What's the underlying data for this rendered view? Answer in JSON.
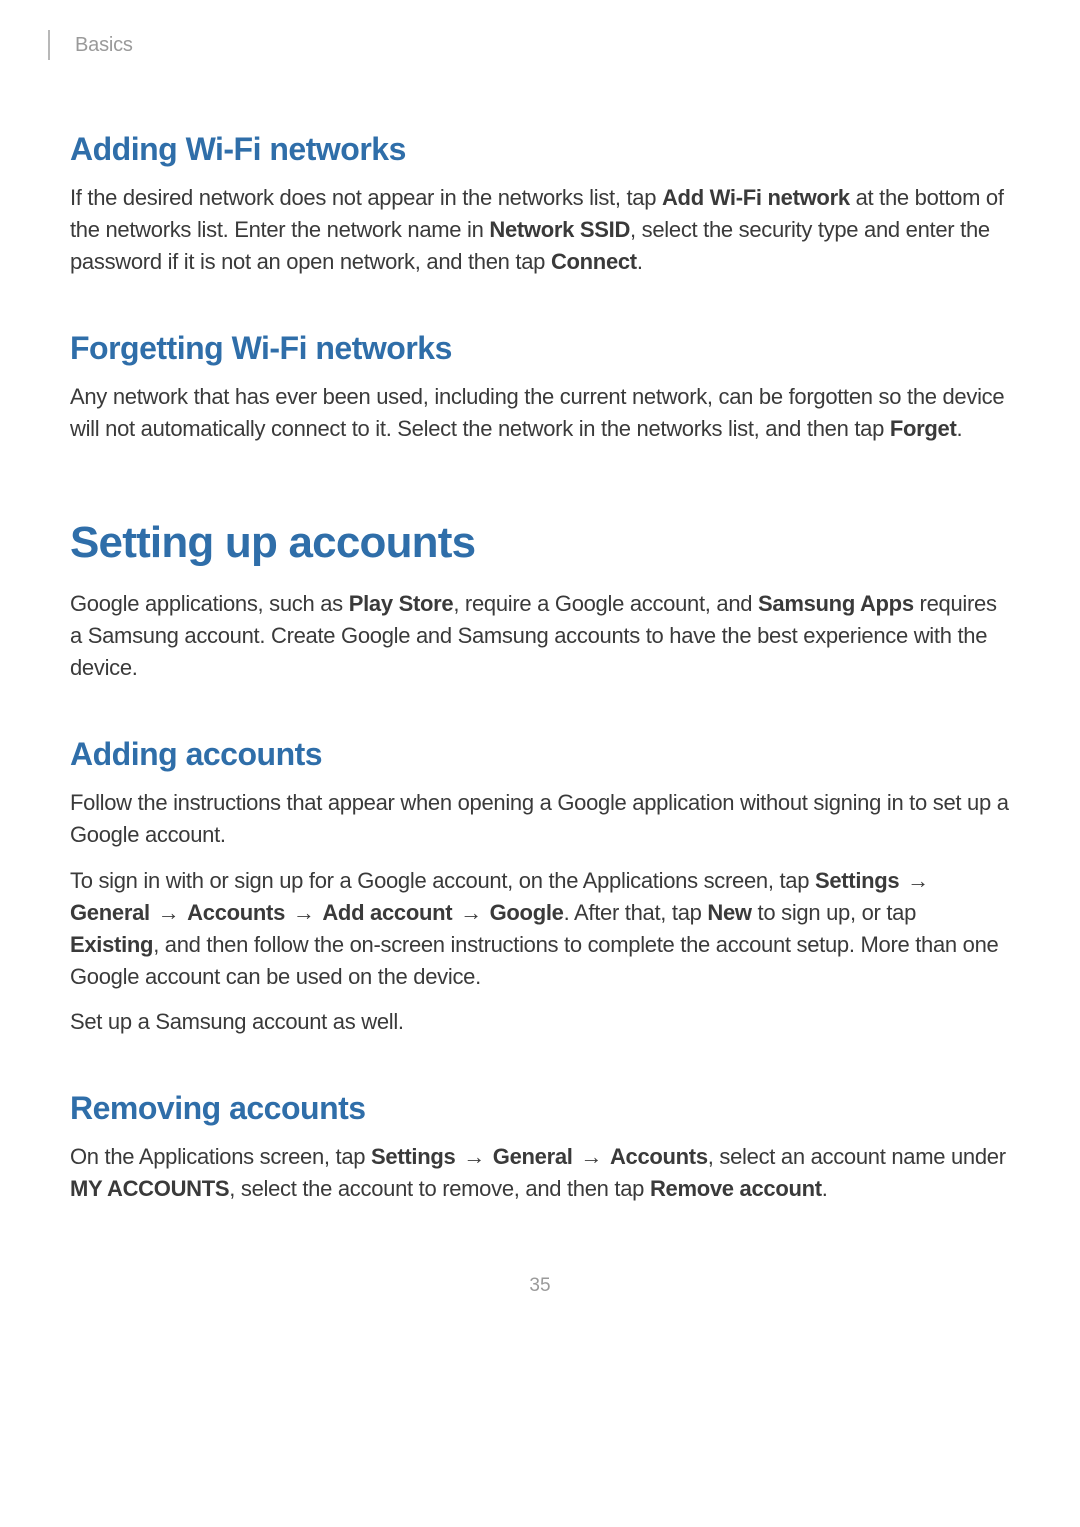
{
  "header": {
    "breadcrumb": "Basics"
  },
  "sections": {
    "adding_wifi": {
      "heading": "Adding Wi-Fi networks",
      "p1_pre": "If the desired network does not appear in the networks list, tap ",
      "p1_b1": "Add Wi-Fi network",
      "p1_mid1": " at the bottom of the networks list. Enter the network name in ",
      "p1_b2": "Network SSID",
      "p1_mid2": ", select the security type and enter the password if it is not an open network, and then tap ",
      "p1_b3": "Connect",
      "p1_post": "."
    },
    "forgetting_wifi": {
      "heading": "Forgetting Wi-Fi networks",
      "p1_pre": "Any network that has ever been used, including the current network, can be forgotten so the device will not automatically connect to it. Select the network in the networks list, and then tap ",
      "p1_b1": "Forget",
      "p1_post": "."
    },
    "setting_up": {
      "heading": "Setting up accounts",
      "p1_pre": "Google applications, such as ",
      "p1_b1": "Play Store",
      "p1_mid1": ", require a Google account, and ",
      "p1_b2": "Samsung Apps",
      "p1_post": " requires a Samsung account. Create Google and Samsung accounts to have the best experience with the device."
    },
    "adding_accounts": {
      "heading": "Adding accounts",
      "p1": "Follow the instructions that appear when opening a Google application without signing in to set up a Google account.",
      "p2_pre": "To sign in with or sign up for a Google account, on the Applications screen, tap ",
      "p2_b1": "Settings",
      "arrow": "→",
      "p2_b2": "General",
      "p2_b3": "Accounts",
      "p2_b4": "Add account",
      "p2_b5": "Google",
      "p2_mid1": ". After that, tap ",
      "p2_b6": "New",
      "p2_mid2": " to sign up, or tap ",
      "p2_b7": "Existing",
      "p2_post": ", and then follow the on-screen instructions to complete the account setup. More than one Google account can be used on the device.",
      "p3": "Set up a Samsung account as well."
    },
    "removing_accounts": {
      "heading": "Removing accounts",
      "p1_pre": "On the Applications screen, tap ",
      "p1_b1": "Settings",
      "p1_b2": "General",
      "p1_b3": "Accounts",
      "p1_mid1": ", select an account name under ",
      "p1_b4": "MY ACCOUNTS",
      "p1_mid2": ", select the account to remove, and then tap ",
      "p1_b5": "Remove account",
      "p1_post": "."
    }
  },
  "page_number": "35"
}
